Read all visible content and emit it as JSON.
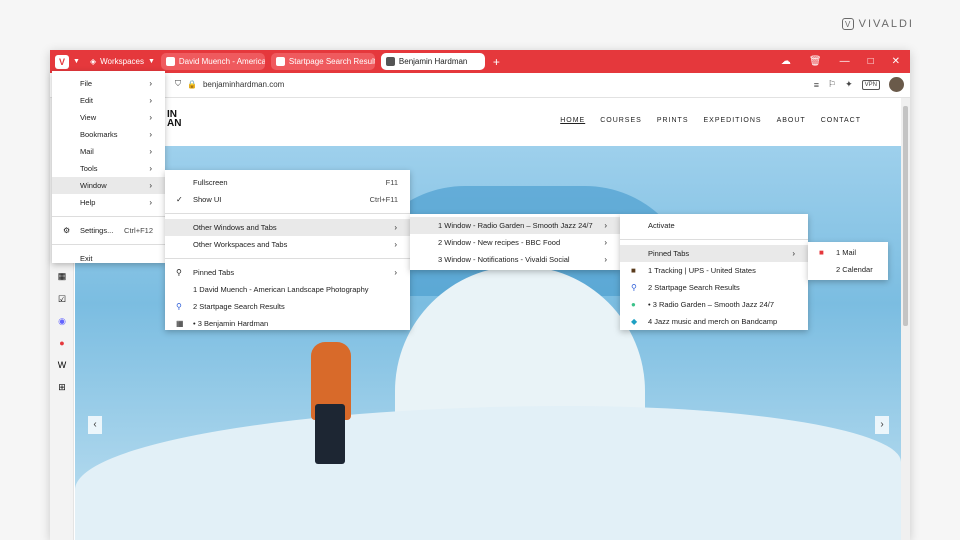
{
  "brand": {
    "name": "VIVALDI",
    "mark": "V"
  },
  "tabbar": {
    "workspaces": "Workspaces",
    "tabs": [
      {
        "title": "David Muench - American"
      },
      {
        "title": "Startpage Search Results"
      },
      {
        "title": "Benjamin Hardman"
      }
    ]
  },
  "address": {
    "url": "benjaminhardman.com",
    "vpn": "VPN"
  },
  "site": {
    "logo_line1": "IN",
    "logo_line2": "AN",
    "nav": [
      "HOME",
      "COURSES",
      "PRINTS",
      "EXPEDITIONS",
      "ABOUT",
      "CONTACT"
    ]
  },
  "menu_main": {
    "items": [
      {
        "label": "File"
      },
      {
        "label": "Edit"
      },
      {
        "label": "View"
      },
      {
        "label": "Bookmarks"
      },
      {
        "label": "Mail"
      },
      {
        "label": "Tools"
      },
      {
        "label": "Window"
      },
      {
        "label": "Help"
      }
    ],
    "settings": "Settings...",
    "settings_shortcut": "Ctrl+F12",
    "exit": "Exit"
  },
  "menu_window": {
    "fullscreen": "Fullscreen",
    "fullscreen_shortcut": "F11",
    "show_ui": "Show UI",
    "show_ui_shortcut": "Ctrl+F11",
    "other_windows": "Other Windows and Tabs",
    "other_workspaces": "Other Workspaces and Tabs",
    "pinned": "Pinned Tabs",
    "tabs": [
      "1 David Muench - American Landscape Photography",
      "2 Startpage Search Results",
      "• 3 Benjamin Hardman"
    ]
  },
  "menu_other": {
    "items": [
      "1 Window - Radio Garden – Smooth Jazz 24/7",
      "2 Window - New recipes - BBC Food",
      "3 Window - Notifications - Vivaldi Social"
    ]
  },
  "menu_w1": {
    "activate": "Activate",
    "pinned": "Pinned Tabs",
    "tabs": [
      "1 Tracking | UPS - United States",
      "2 Startpage Search Results",
      "• 3 Radio Garden – Smooth Jazz 24/7",
      "4 Jazz music and merch on Bandcamp"
    ]
  },
  "menu_pinned": {
    "items": [
      "1 Mail",
      "2 Calendar"
    ]
  }
}
